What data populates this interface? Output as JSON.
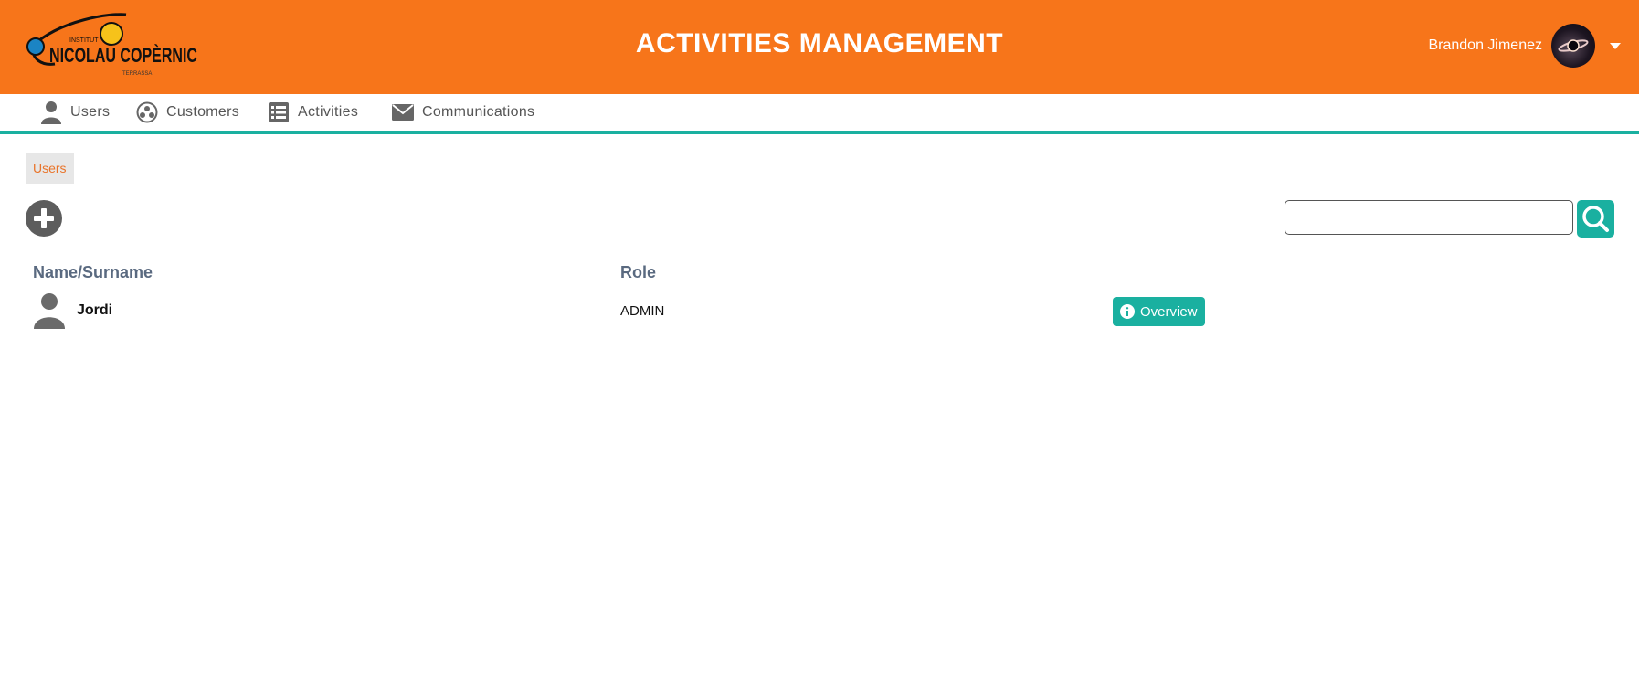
{
  "header": {
    "title": "ACTIVITIES MANAGEMENT",
    "brand_color": "#f7751a",
    "accent_color": "#1ab0a0",
    "logo_text": "NICOLAU COPÈRNIC",
    "logo_top_text": "INSTITUT",
    "logo_sub_text": "TERRASSA",
    "user_name": "Brandon Jimenez"
  },
  "nav": {
    "items": [
      {
        "label": "Users",
        "icon": "user-icon"
      },
      {
        "label": "Customers",
        "icon": "customers-icon"
      },
      {
        "label": "Activities",
        "icon": "list-icon"
      },
      {
        "label": "Communications",
        "icon": "envelope-icon"
      }
    ]
  },
  "breadcrumb": {
    "current": "Users"
  },
  "search": {
    "placeholder": "",
    "value": ""
  },
  "table": {
    "columns": [
      "Name/Surname",
      "Role"
    ],
    "rows": [
      {
        "name": "Jordi",
        "role": "ADMIN",
        "action": "Overview"
      }
    ]
  }
}
